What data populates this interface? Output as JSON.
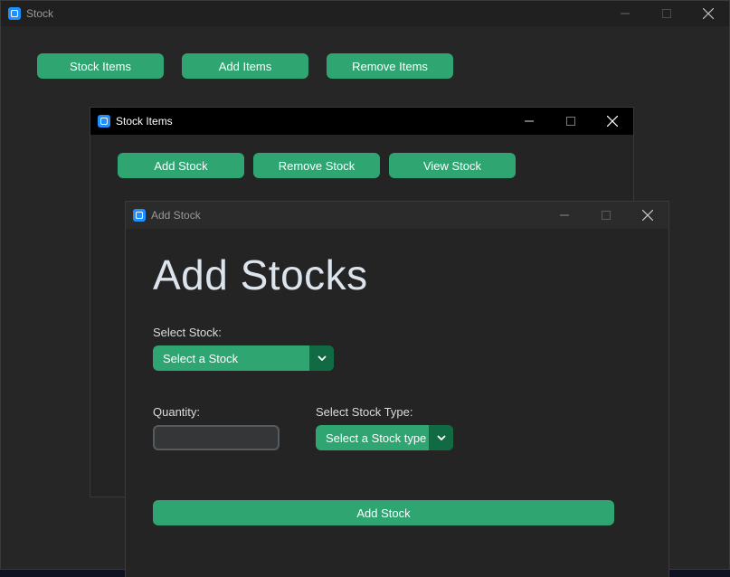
{
  "colors": {
    "accent": "#2fa572",
    "accent_dark": "#106a43",
    "window_bg": "#242424",
    "titlebar_active": "#000000",
    "titlebar_inactive": "#202020",
    "entry_bg": "#343638",
    "entry_border": "#565b5e"
  },
  "main_window": {
    "title": "Stock",
    "buttons": [
      "Stock Items",
      "Add Items",
      "Remove Items"
    ]
  },
  "stock_items_window": {
    "title": "Stock Items",
    "buttons": [
      "Add Stock",
      "Remove Stock",
      "View Stock"
    ]
  },
  "add_stock_window": {
    "title": "Add Stock",
    "heading": "Add Stocks",
    "select_stock_label": "Select Stock:",
    "select_stock_value": "Select a Stock",
    "quantity_label": "Quantity:",
    "quantity_value": "",
    "stock_type_label": "Select Stock Type:",
    "stock_type_value": "Select a Stock type",
    "submit_label": "Add Stock"
  },
  "window_controls": {
    "minimize_icon": "minimize-icon",
    "maximize_icon": "maximize-icon",
    "close_icon": "close-icon"
  }
}
